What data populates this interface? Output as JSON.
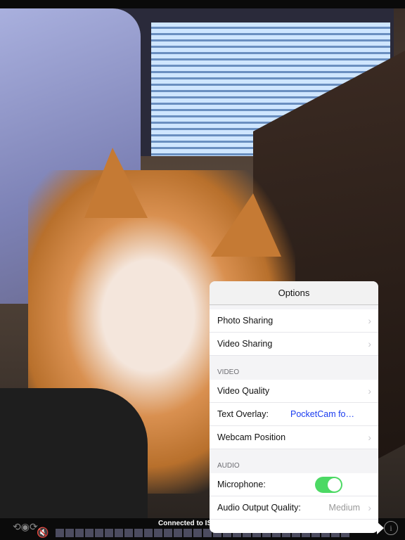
{
  "status": {
    "text": "Connected to ISS"
  },
  "colors": {
    "accent": "#1a3cf0",
    "toggle_on": "#4cd964"
  },
  "icons": {
    "rotate": "camera-rotate-icon",
    "mute": "speaker-muted-icon",
    "info": "info-icon"
  },
  "options": {
    "title": "Options",
    "items": [
      {
        "label": "Photo Sharing"
      },
      {
        "label": "Video Sharing"
      }
    ],
    "video_section": "VIDEO",
    "video_items": {
      "quality": "Video Quality",
      "overlay_label": "Text Overlay:",
      "overlay_value": "PocketCam fo…",
      "position": "Webcam Position"
    },
    "audio_section": "AUDIO",
    "audio_items": {
      "mic_label": "Microphone:",
      "mic_on": true,
      "quality_label": "Audio Output Quality:",
      "quality_value": "Medium"
    }
  }
}
